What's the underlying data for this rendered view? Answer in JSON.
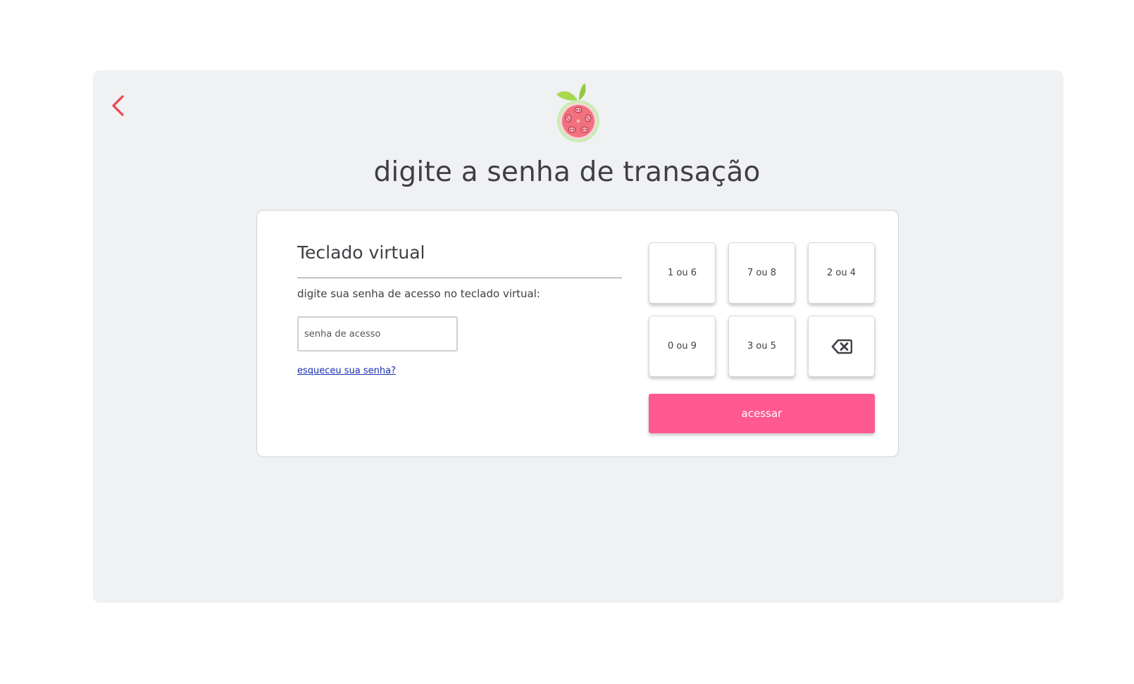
{
  "header": {
    "title": "digite a senha de transação",
    "back_icon": "chevron-left-icon",
    "logo": "guava-fruit-logo"
  },
  "keyboard_panel": {
    "title": "Teclado virtual",
    "instruction": "digite sua senha de acesso no teclado virtual:",
    "password_placeholder": "senha de acesso",
    "password_value": "",
    "forgot_link": "esqueceu sua senha?"
  },
  "keypad": {
    "keys": [
      "1 ou 6",
      "7 ou 8",
      "2 ou 4",
      "0 ou 9",
      "3 ou 5"
    ],
    "backspace_icon": "backspace-icon",
    "submit_label": "acessar"
  },
  "colors": {
    "accent": "#ff5991",
    "back_arrow": "#f0454b",
    "background_panel": "#f0f1f3",
    "link": "#1a2fb0",
    "text": "#3f3f45"
  }
}
